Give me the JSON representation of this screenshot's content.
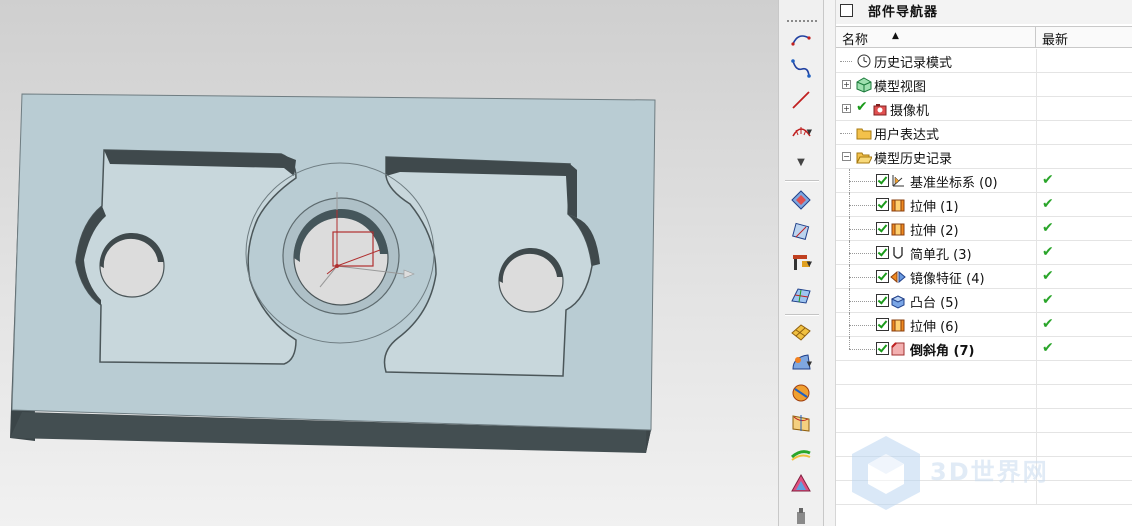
{
  "navigator": {
    "title": "部件导航器",
    "columns": {
      "name": "名称",
      "latest": "最新"
    },
    "rows": [
      {
        "label": "历史记录模式",
        "icon": "clock-icon",
        "expander": "",
        "latest": ""
      },
      {
        "label": "模型视图",
        "icon": "model-view-icon",
        "expander": "+",
        "latest": ""
      },
      {
        "label": "摄像机",
        "icon": "camera-icon",
        "expander": "+",
        "latest": ""
      },
      {
        "label": "用户表达式",
        "icon": "folder-icon",
        "expander": "",
        "latest": ""
      },
      {
        "label": "模型历史记录",
        "icon": "folder-open-icon",
        "expander": "−",
        "latest": ""
      },
      {
        "label": "基准坐标系 (0)",
        "icon": "datum-csys-icon",
        "expander": "",
        "latest": "✔"
      },
      {
        "label": "拉伸 (1)",
        "icon": "extrude-icon",
        "expander": "",
        "latest": "✔"
      },
      {
        "label": "拉伸 (2)",
        "icon": "extrude-icon",
        "expander": "",
        "latest": "✔"
      },
      {
        "label": "简单孔 (3)",
        "icon": "hole-icon",
        "expander": "",
        "latest": "✔"
      },
      {
        "label": "镜像特征 (4)",
        "icon": "mirror-icon",
        "expander": "",
        "latest": "✔"
      },
      {
        "label": "凸台 (5)",
        "icon": "boss-icon",
        "expander": "",
        "latest": "✔"
      },
      {
        "label": "拉伸 (6)",
        "icon": "extrude-icon",
        "expander": "",
        "latest": "✔"
      },
      {
        "label": "倒斜角 (7)",
        "icon": "chamfer-icon",
        "expander": "",
        "latest": "✔"
      }
    ]
  },
  "watermark": {
    "text": "3D世界网"
  },
  "colors": {
    "part_face": "#b9ccd3",
    "part_side": "#3f4a4d",
    "check_green": "#2aa52a"
  }
}
